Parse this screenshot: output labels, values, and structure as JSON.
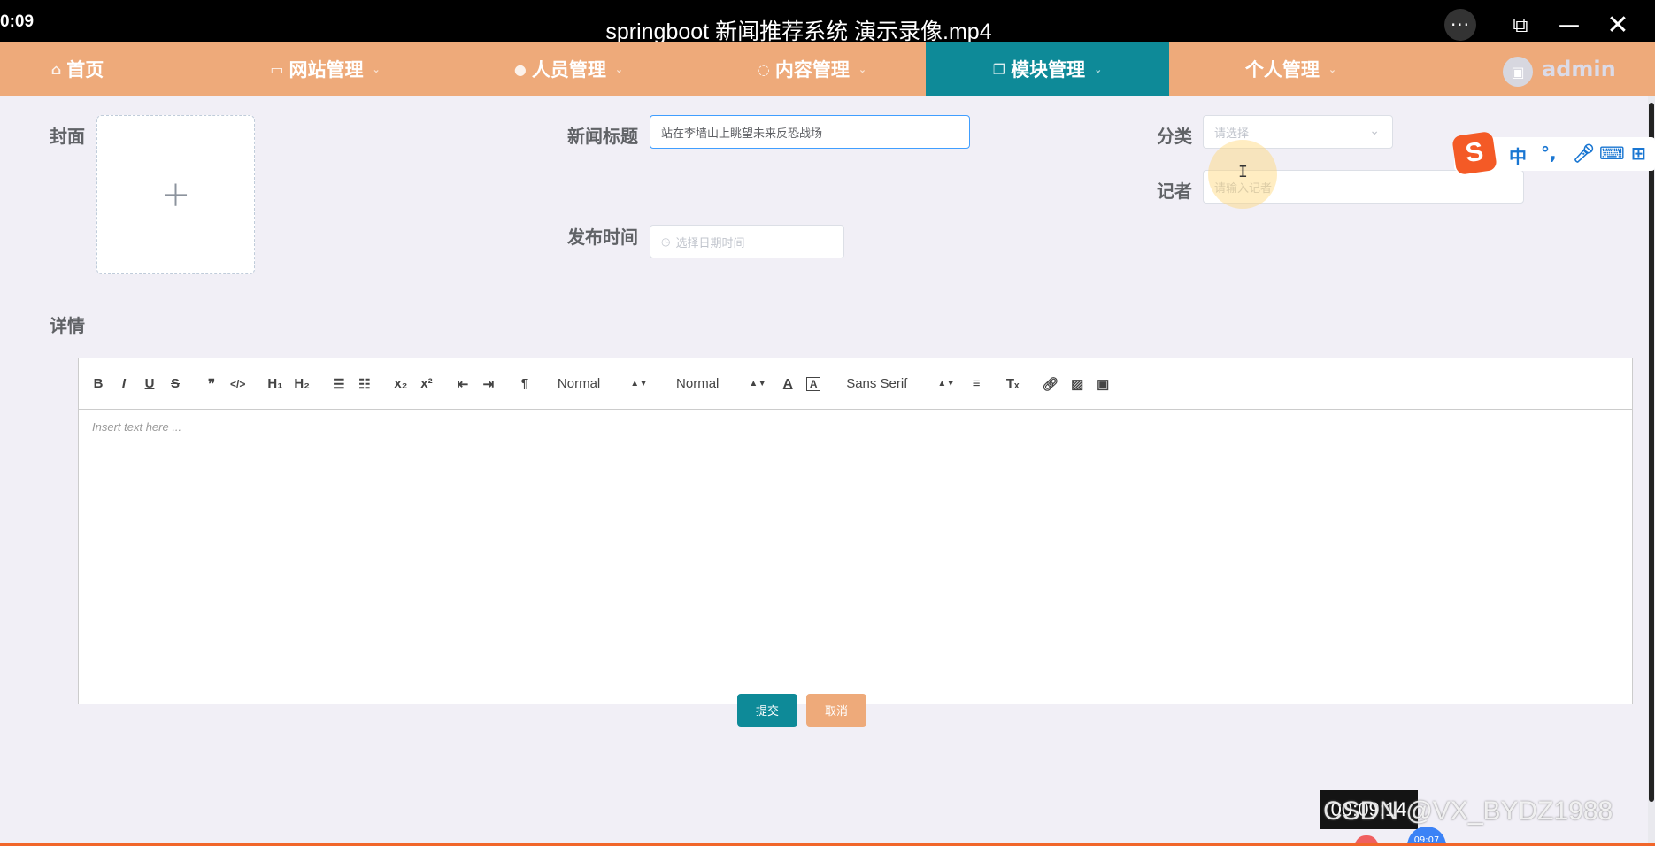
{
  "player": {
    "clock": "0:09",
    "title": "springboot 新闻推荐系统 演示录像.mp4",
    "more_label": "···",
    "pip_label": "⧉",
    "min_label": "—",
    "close_label": "✕"
  },
  "nav": {
    "items": [
      {
        "icon": "⌂",
        "label": "首页"
      },
      {
        "icon": "▭",
        "label": "网站管理"
      },
      {
        "icon": "●",
        "label": "人员管理"
      },
      {
        "icon": "◌",
        "label": "内容管理"
      },
      {
        "icon": "❐",
        "label": "模块管理"
      },
      {
        "icon": "",
        "label": "个人管理"
      }
    ],
    "active": "模块管理",
    "user": "admin",
    "accent_color": "#eeaa7a",
    "active_color": "#0e8a98"
  },
  "form": {
    "cover_label": "封面",
    "title_label": "新闻标题",
    "title_value": "站在李墙山上眺望未来反恐战场",
    "category_label": "分类",
    "category_placeholder": "请选择",
    "reporter_label": "记者",
    "reporter_placeholder": "请输入记者",
    "publish_label": "发布时间",
    "publish_placeholder": "选择日期时间",
    "detail_label": "详情"
  },
  "editor": {
    "header_select": "Normal",
    "size_select": "Normal",
    "font_select": "Sans Serif",
    "placeholder": "Insert text here ..."
  },
  "buttons": {
    "submit": "提交",
    "cancel": "取消"
  },
  "ime": {
    "logo": "S",
    "mode": "中"
  },
  "overlay": {
    "timestamp": "00:09:14",
    "watermark": "CSDN @VX_BYDZ1988",
    "rec_time": "09:07"
  }
}
